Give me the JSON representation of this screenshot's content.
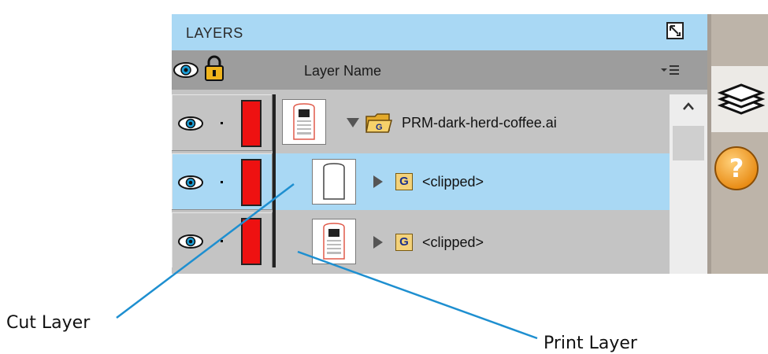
{
  "panel": {
    "title": "LAYERS",
    "column_header": "Layer Name",
    "icons": {
      "expand": "expand-panel-icon",
      "visibility": "eye-icon",
      "lock": "lock-icon",
      "menu": "panel-menu-icon"
    },
    "layers": [
      {
        "name": "PRM-dark-herd-coffee.ai",
        "kind": "file",
        "expanded": true,
        "visible": true,
        "selected": false,
        "color": "#ee1111"
      },
      {
        "name": "<clipped>",
        "kind": "group",
        "badge": "G",
        "expanded": false,
        "visible": true,
        "selected": true,
        "color": "#ee1111"
      },
      {
        "name": "<clipped>",
        "kind": "group",
        "badge": "G",
        "expanded": false,
        "visible": true,
        "selected": false,
        "color": "#ee1111"
      }
    ]
  },
  "dock": {
    "layers_tab_icon": "layers-stack-icon",
    "help_icon": "help-question-icon"
  },
  "callouts": {
    "cut_layer": "Cut Layer",
    "print_layer": "Print Layer"
  },
  "colors": {
    "selected_row": "#a9d8f4",
    "row": "#c4c4c4",
    "callout_line": "#1e8fd0",
    "layer_color": "#ee1111"
  }
}
